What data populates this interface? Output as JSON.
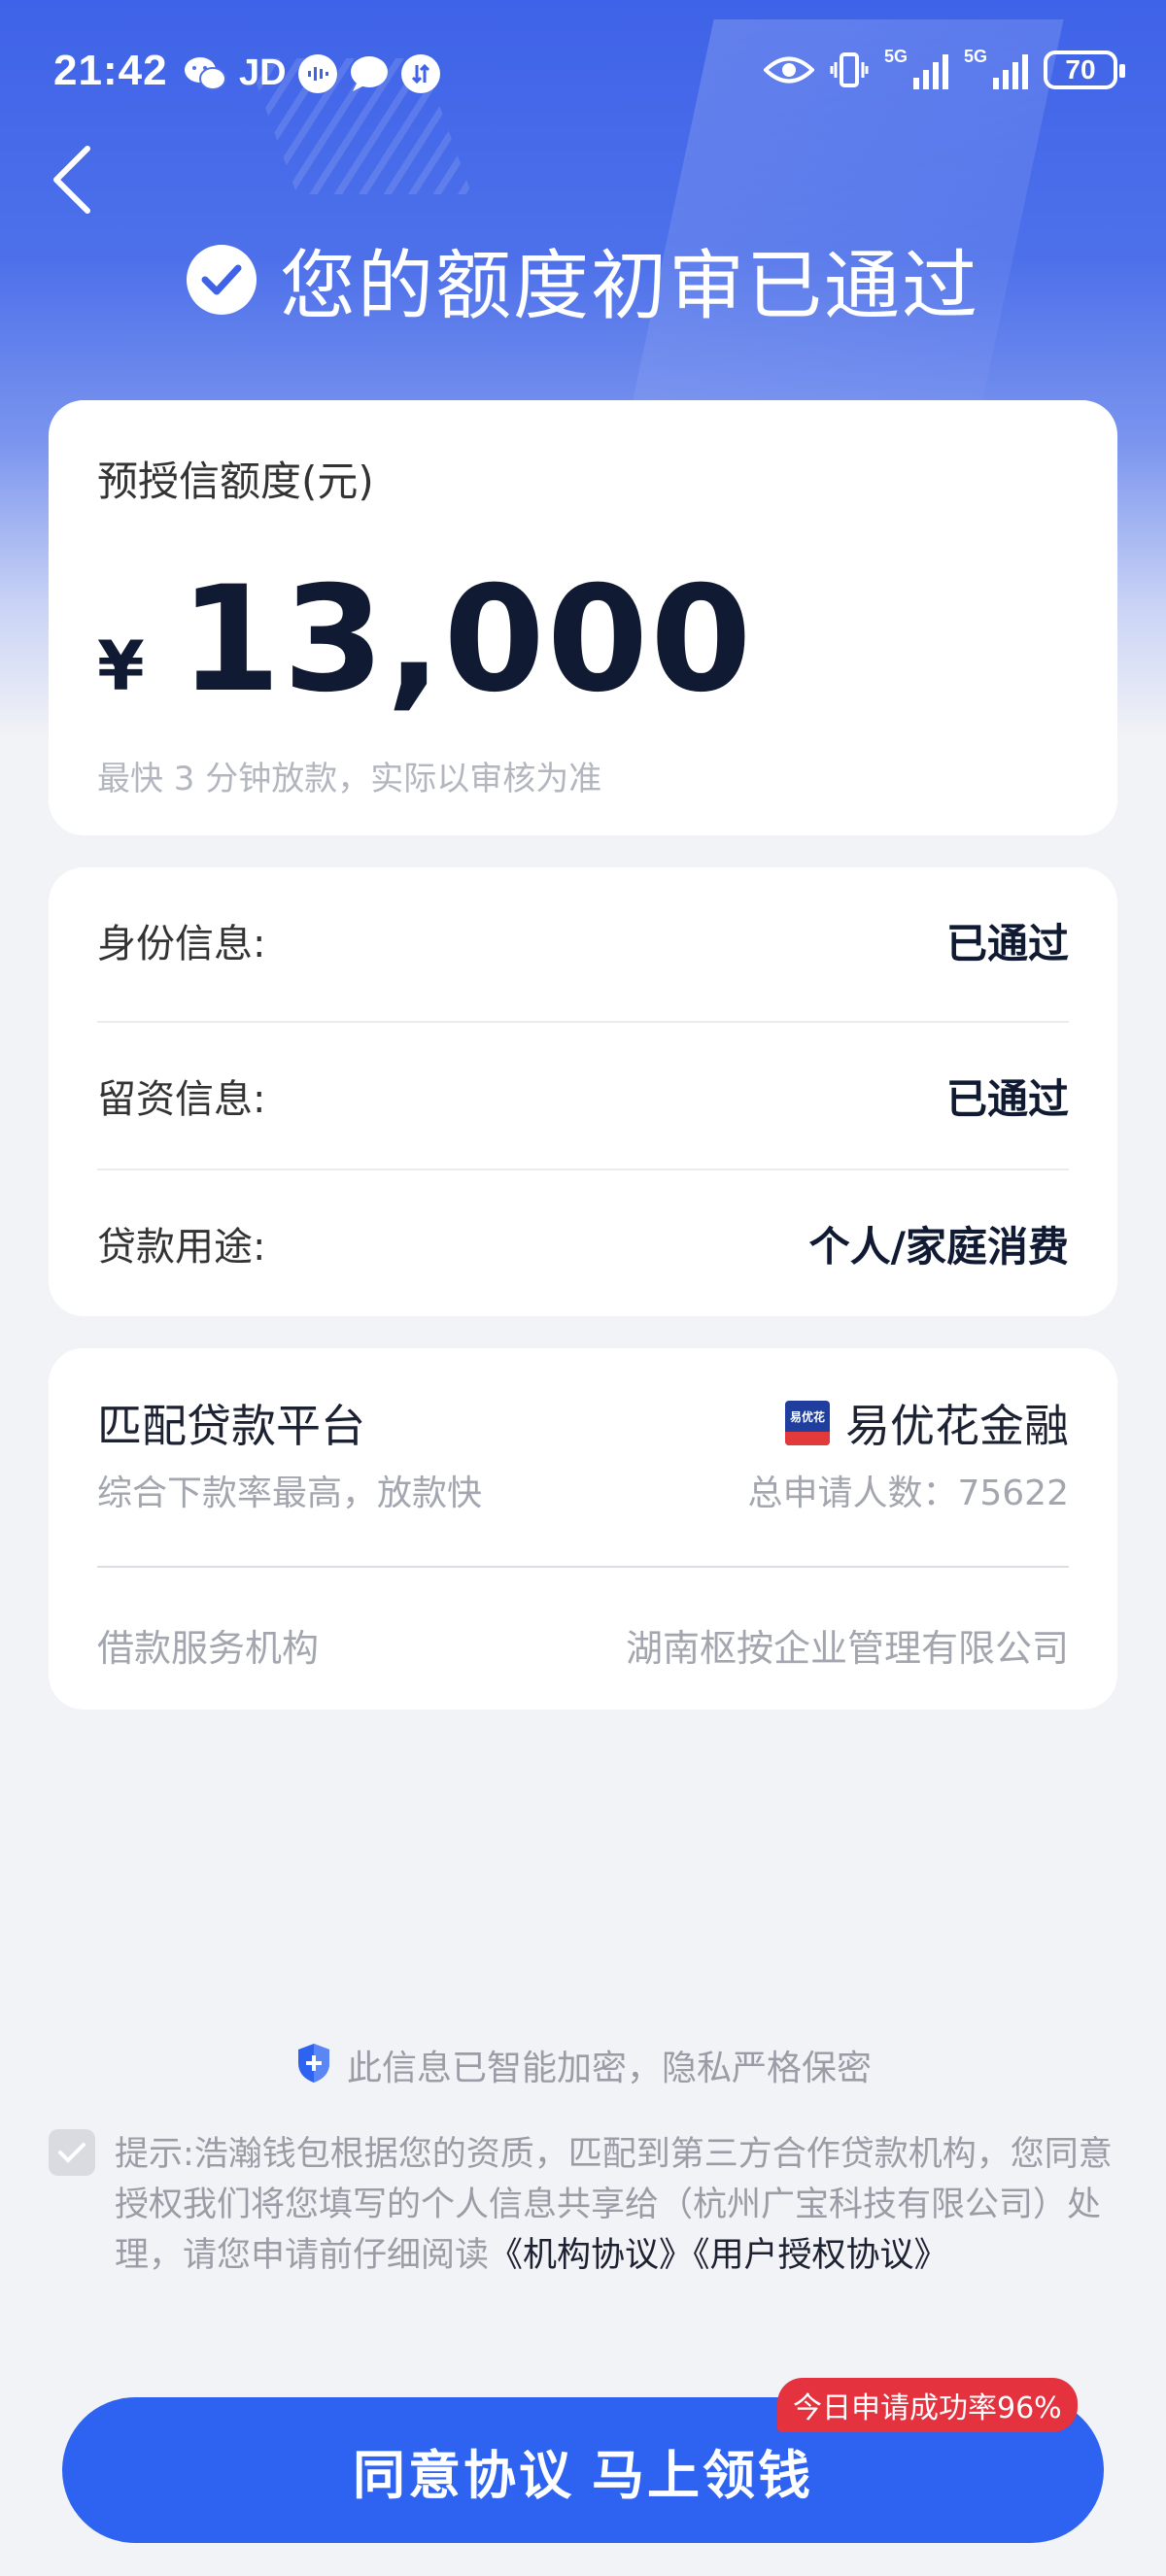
{
  "status_bar": {
    "time": "21:42",
    "left_icons": [
      "wechat-icon",
      "JD",
      "audio-icon",
      "chat-icon",
      "transfer-icon"
    ],
    "jd_label": "JD",
    "net1": "5G",
    "net2": "5G",
    "battery": "70"
  },
  "header": {
    "title": "您的额度初审已通过"
  },
  "amount_card": {
    "label": "预授信额度(元)",
    "currency": "¥",
    "value": "13,000",
    "note": "最快 3 分钟放款，实际以审核为准"
  },
  "info_card": {
    "rows": [
      {
        "key": "身份信息:",
        "value": "已通过"
      },
      {
        "key": "留资信息:",
        "value": "已通过"
      },
      {
        "key": "贷款用途:",
        "value": "个人/家庭消费"
      }
    ]
  },
  "platform_card": {
    "title": "匹配贷款平台",
    "subtitle": "综合下款率最高，放款快",
    "brand_logo_text": "易优花",
    "brand_name": "易优花金融",
    "applicant_count": "总申请人数：75622",
    "org_label": "借款服务机构",
    "org_value": "湖南枢按企业管理有限公司"
  },
  "privacy": {
    "text": "此信息已智能加密，隐私严格保密"
  },
  "notice": {
    "text_before": "提示:浩瀚钱包根据您的资质，匹配到第三方合作贷款机构，您同意授权我们将您填写的个人信息共享给（杭州广宝科技有限公司）处理，请您申请前仔细阅读",
    "link1": "《机构协议》",
    "link2": "《用户授权协议》"
  },
  "cta": {
    "label": "同意协议 马上领钱",
    "badge": "今日申请成功率96%"
  },
  "colors": {
    "primary": "#2d63f0",
    "hero_top": "#3f63e8",
    "badge_red": "#e5323f",
    "background": "#f2f3f6"
  }
}
